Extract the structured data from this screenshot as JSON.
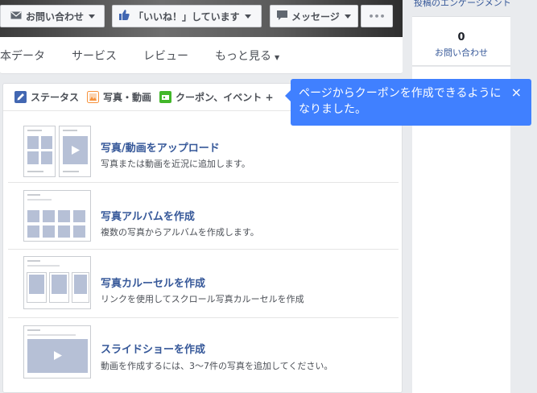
{
  "header": {
    "buttons": [
      {
        "label": "お問い合わせ",
        "icon": "envelope-icon"
      },
      {
        "label": "「いいね！」しています",
        "icon": "thumbs-up-icon"
      },
      {
        "label": "メッセージ",
        "icon": "message-icon"
      },
      {
        "label": "•••",
        "icon": "more-icon"
      }
    ]
  },
  "nav": {
    "tabs": [
      "基本データ",
      "サービス",
      "レビュー",
      "もっと見る"
    ],
    "more_caret": "▼"
  },
  "right": {
    "heading": "投稿のエンゲージメント",
    "count": "0",
    "count_label": "お問い合わせ"
  },
  "composer": {
    "tabs": [
      {
        "label": "ステータス",
        "icon": "pencil-icon",
        "color": "#4267b2"
      },
      {
        "label": "写真・動画",
        "icon": "photo-icon",
        "color": "#f7923b"
      },
      {
        "label": "クーポン、イベント +",
        "icon": "coupon-icon",
        "color": "#42b72a"
      }
    ],
    "options": [
      {
        "title": "写真/動画をアップロード",
        "desc": "写真または動画を近況に追加します。"
      },
      {
        "title": "写真アルバムを作成",
        "desc": "複数の写真からアルバムを作成します。"
      },
      {
        "title": "写真カルーセルを作成",
        "desc": "リンクを使用してスクロール写真カルーセルを作成"
      },
      {
        "title": "スライドショーを作成",
        "desc": "動画を作成するには、3〜7件の写真を追加してください。"
      }
    ]
  },
  "tooltip": {
    "text": "ページからクーポンを作成できるようになりました。",
    "close": "×"
  },
  "colors": {
    "link": "#365899",
    "tooltip_bg": "#4080ff",
    "thumb_tile": "#b6c0d6"
  }
}
